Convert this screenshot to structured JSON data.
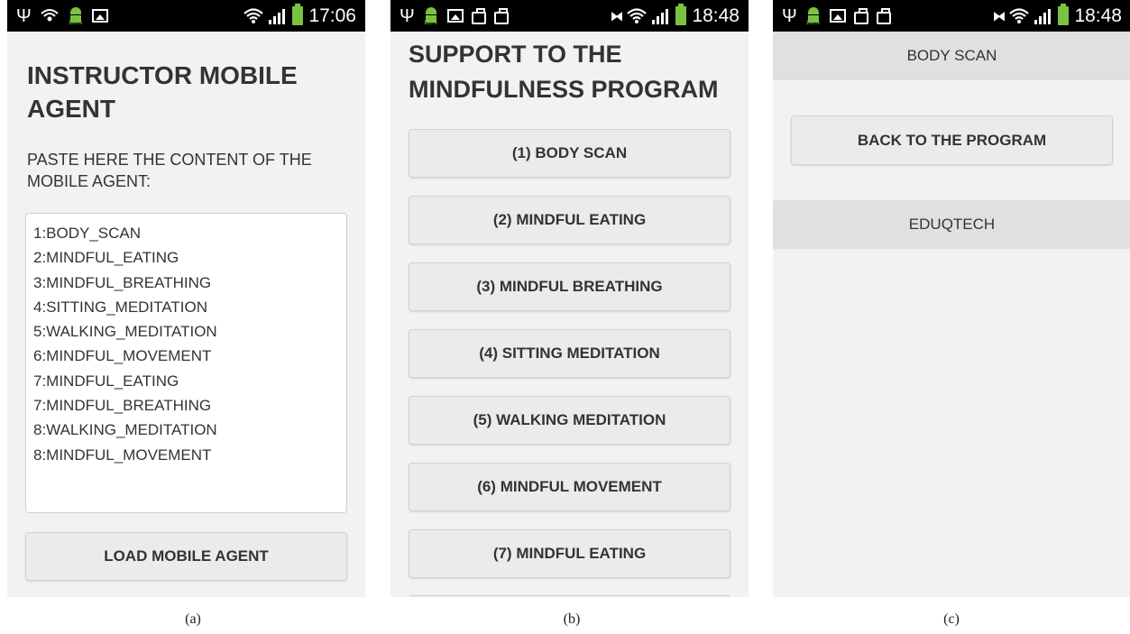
{
  "screens": [
    {
      "caption": "(a)",
      "status": {
        "time": "17:06"
      },
      "title": "INSTRUCTOR MOBILE AGENT",
      "instruction": "PASTE HERE THE CONTENT OF THE MOBILE AGENT:",
      "agent_lines": [
        "1:BODY_SCAN",
        "2:MINDFUL_EATING",
        "3:MINDFUL_BREATHING",
        "4:SITTING_MEDITATION",
        "5:WALKING_MEDITATION",
        "6:MINDFUL_MOVEMENT",
        "7:MINDFUL_EATING",
        "7:MINDFUL_BREATHING",
        "8:WALKING_MEDITATION",
        "8:MINDFUL_MOVEMENT"
      ],
      "load_button": "LOAD MOBILE AGENT"
    },
    {
      "caption": "(b)",
      "status": {
        "time": "18:48"
      },
      "title_line1": "SUPPORT TO THE",
      "title_line2": "MINDFULNESS PROGRAM",
      "program_buttons": [
        "(1) BODY SCAN",
        "(2) MINDFUL EATING",
        "(3) MINDFUL BREATHING",
        "(4) SITTING MEDITATION",
        "(5) WALKING MEDITATION",
        "(6) MINDFUL MOVEMENT",
        "(7) MINDFUL EATING"
      ]
    },
    {
      "caption": "(c)",
      "status": {
        "time": "18:48"
      },
      "header": "BODY SCAN",
      "back_button": "BACK TO THE PROGRAM",
      "footer": "EDUQTECH"
    }
  ],
  "icons": {
    "usb": "usb-icon",
    "android": "android-icon",
    "wifi": "wifi-icon",
    "signal": "signal-icon",
    "battery": "battery-icon",
    "image": "image-icon",
    "bag": "bag-icon",
    "mute": "mute-icon",
    "nfc": "nfc-icon"
  },
  "colors": {
    "statusbar": "#000000",
    "battery": "#7cc242",
    "screen_bg": "#f2f2f2",
    "button_bg": "#ebebeb"
  }
}
